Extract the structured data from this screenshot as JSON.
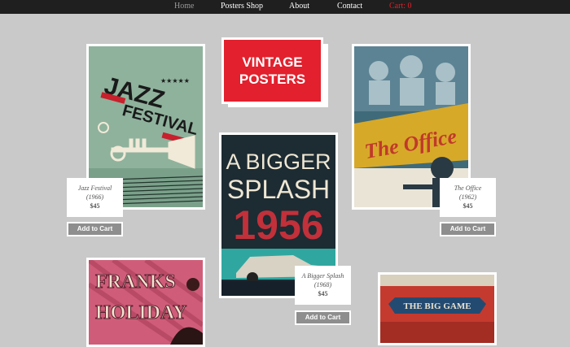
{
  "nav": {
    "home": "Home",
    "shop": "Posters Shop",
    "about": "About",
    "contact": "Contact",
    "cart": "Cart: 0"
  },
  "logo": {
    "line1": "VINTAGE",
    "line2": "POSTERS"
  },
  "products": [
    {
      "title": "Jazz Festival",
      "year": "(1966)",
      "price": "$45",
      "button": "Add to Cart",
      "art_text": "JAZZ FESTIVAL"
    },
    {
      "title": "A Bigger Splash",
      "year": "(1968)",
      "price": "$45",
      "button": "Add to Cart",
      "art_text1": "A BIGGER",
      "art_text2": "SPLASH",
      "art_year": "1956"
    },
    {
      "title": "The Office",
      "year": "(1962)",
      "price": "$45",
      "button": "Add to Cart",
      "art_text": "The Office"
    },
    {
      "art_text1": "FRANKS",
      "art_text2": "HOLIDAY"
    },
    {
      "art_text": "THE BIG GAME"
    }
  ],
  "colors": {
    "accent": "#e3202d",
    "nav_bg": "#1f1f1f",
    "page_bg": "#c9c9c9",
    "button_bg": "#8e8e8e"
  }
}
